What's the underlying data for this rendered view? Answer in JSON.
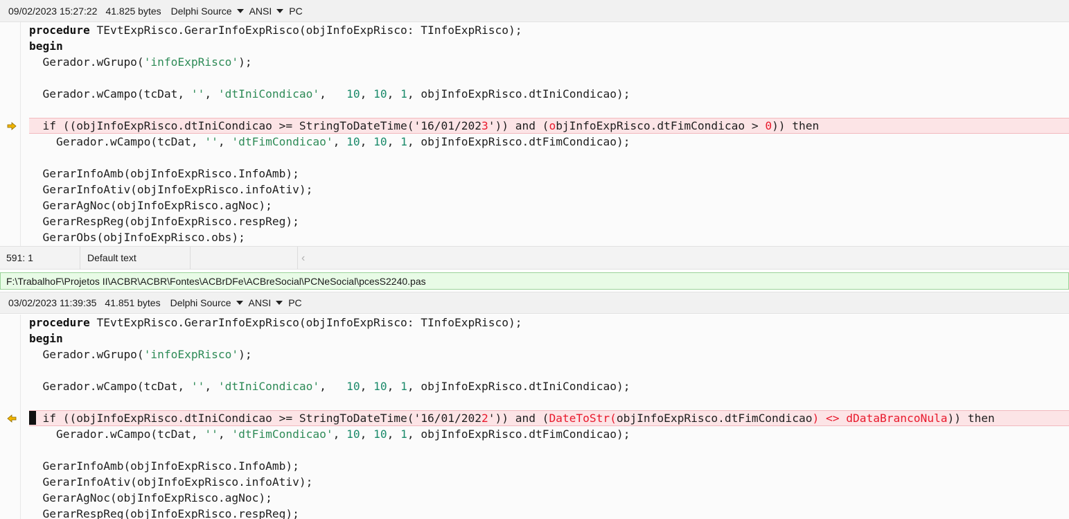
{
  "top_pane": {
    "datetime": "09/02/2023 15:27:22",
    "size": "41.825 bytes",
    "syntax": "Delphi Source",
    "encoding": "ANSI",
    "line_ending": "PC"
  },
  "bottom_pane": {
    "datetime": "03/02/2023 11:39:35",
    "size": "41.851 bytes",
    "syntax": "Delphi Source",
    "encoding": "ANSI",
    "line_ending": "PC"
  },
  "code_common": {
    "proc_kw": "procedure",
    "proc_rest": " TEvtExpRisco.GerarInfoExpRisco(objInfoExpRisco: TInfoExpRisco);",
    "begin_kw": "begin",
    "grupo_a": "  Gerador.wGrupo(",
    "grupo_str": "'infoExpRisco'",
    "grupo_b": ");",
    "campo1_a": "  Gerador.wCampo(tcDat, ",
    "campo1_s1": "''",
    "campo1_b": ", ",
    "campo1_s2": "'dtIniCondicao'",
    "campo1_c": ",   ",
    "campo1_n1": "10",
    "campo1_d": ", ",
    "campo1_n2": "10",
    "campo1_e": ", ",
    "campo1_n3": "1",
    "campo1_f": ", objInfoExpRisco.dtIniCondicao);",
    "campo2_a": "    Gerador.wCampo(tcDat, ",
    "campo2_s1": "''",
    "campo2_b": ", ",
    "campo2_s2": "'dtFimCondicao'",
    "campo2_c": ", ",
    "campo2_n1": "10",
    "campo2_d": ", ",
    "campo2_n2": "10",
    "campo2_e": ", ",
    "campo2_n3": "1",
    "campo2_f": ", objInfoExpRisco.dtFimCondicao);",
    "amb": "  GerarInfoAmb(objInfoExpRisco.InfoAmb);",
    "ativ": "  GerarInfoAtiv(objInfoExpRisco.infoAtiv);",
    "agnoc": "  GerarAgNoc(objInfoExpRisco.agNoc);",
    "resp": "  GerarRespReg(objInfoExpRisco.respReg);",
    "obs": "  GerarObs(objInfoExpRisco.obs);"
  },
  "top_if": {
    "a": "  if ((objInfoExpRisco.dtIniCondicao >= StringToDateTime('16/01/202",
    "a_red": "3",
    "b": "')) and (",
    "b_red": "o",
    "c": "bjInfoExpRisco.dtFimCondicao > ",
    "c_red": "0",
    "d": ")) then"
  },
  "bottom_if": {
    "a": "  if ((objInfoExpRisco.dtIniCondicao >= StringToDateTime('16/01/202",
    "a_red": "2",
    "b": "')) and (",
    "b_red": "DateToStr(",
    "c": "objInfoExpRisco.dtFimCondicao",
    "c_red": ") <> dDataBrancoNula",
    "d": ")) then"
  },
  "status": {
    "position": "591: 1",
    "highlight": "Default text",
    "scroll_left_glyph": "‹"
  },
  "path": "F:\\TrabalhoF\\Projetos II\\ACBR\\ACBR\\Fontes\\ACBrDFe\\ACBreSocial\\PCNeSocial\\pcesS2240.pas",
  "colors": {
    "diff_bg": "#fce4e6",
    "diff_text": "#e8192c",
    "string": "#2e8b57",
    "path_bg": "#e8fbe6",
    "arrow": "#f1b400"
  },
  "icons": {
    "top_marker": "arrow-right-icon",
    "bottom_marker": "arrow-left-icon"
  }
}
